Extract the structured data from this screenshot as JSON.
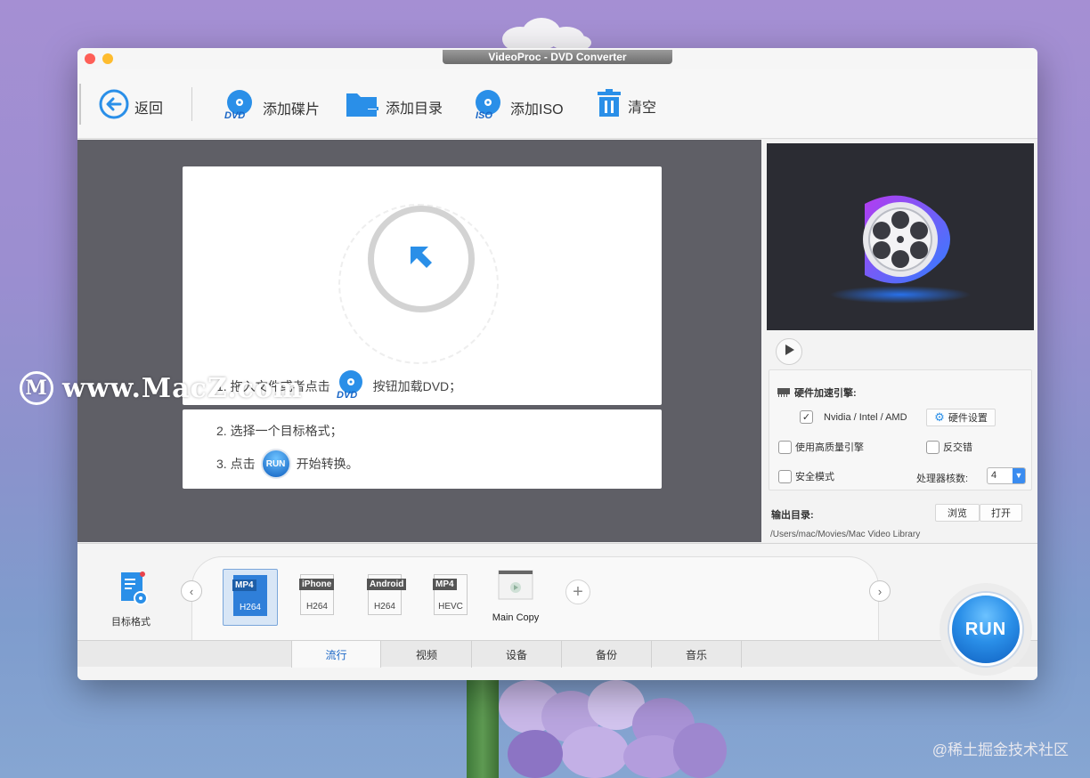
{
  "window": {
    "title": "VideoProc - DVD Converter"
  },
  "toolbar": {
    "back_label": "返回",
    "add_disc_label": "添加碟片",
    "add_folder_label": "添加目录",
    "add_iso_label": "添加ISO",
    "clear_label": "清空"
  },
  "drop": {
    "step1_prefix": "1. 拖入文件或者点击",
    "step1_suffix": "按钮加载DVD；",
    "step2": "2. 选择一个目标格式；",
    "step3_prefix": "3. 点击",
    "step3_suffix": "开始转换。"
  },
  "icons": {
    "dvd_text": "DVD",
    "iso_text": "ISO",
    "run_small": "RUN"
  },
  "hardware": {
    "title": "硬件加速引擎:",
    "gpu_label": "Nvidia /  Intel / AMD",
    "gpu_checked": true,
    "settings_button": "硬件设置",
    "hq_engine_label": "使用高质量引擎",
    "deinterlace_label": "反交错",
    "safe_mode_label": "安全模式",
    "cores_label": "处理器核数:",
    "cores_value": "4"
  },
  "output": {
    "label": "输出目录:",
    "browse_button": "浏览",
    "open_button": "打开",
    "path": "/Users/mac/Movies/Mac Video Library"
  },
  "formats": {
    "target_label": "目标格式",
    "items": [
      {
        "top": "MP4",
        "bottom": "H264",
        "selected": true
      },
      {
        "top": "iPhone",
        "bottom": "H264",
        "selected": false
      },
      {
        "top": "Android",
        "bottom": "H264",
        "selected": false
      },
      {
        "top": "MP4",
        "bottom": "HEVC",
        "selected": false
      }
    ],
    "main_copy_label": "Main Copy",
    "add_symbol": "+"
  },
  "tabs": [
    "流行",
    "视频",
    "设备",
    "备份",
    "音乐"
  ],
  "run_label": "RUN",
  "watermark": {
    "logo_letter": "M",
    "text": "www.MacZ.com"
  },
  "credit": "@稀土掘金技术社区",
  "colors": {
    "accent": "#2a8fe8",
    "dark_area": "#5f5f66"
  }
}
